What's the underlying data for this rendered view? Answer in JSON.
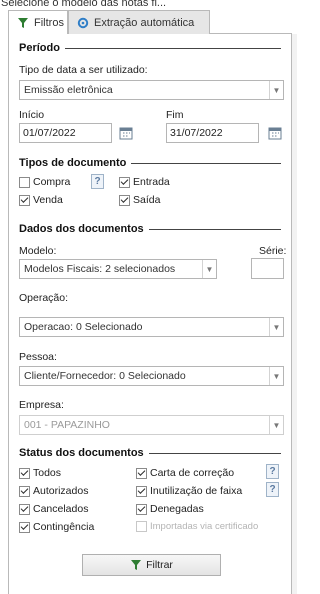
{
  "header_cut_text": "Selecione o modelo das notas fi...",
  "tabs": [
    {
      "label": "Filtros",
      "icon": "filter-icon",
      "active": true
    },
    {
      "label": "Extração automática",
      "icon": "gear-icon",
      "active": false
    }
  ],
  "periodo": {
    "title": "Período",
    "date_type_label": "Tipo de data a ser utilizado:",
    "date_type_value": "Emissão eletrônica",
    "inicio_label": "Início",
    "inicio_value": "01/07/2022",
    "fim_label": "Fim",
    "fim_value": "31/07/2022"
  },
  "tipos": {
    "title": "Tipos de documento",
    "compra": {
      "label": "Compra",
      "checked": false
    },
    "entrada": {
      "label": "Entrada",
      "checked": true
    },
    "venda": {
      "label": "Venda",
      "checked": true
    },
    "saida": {
      "label": "Saída",
      "checked": true
    }
  },
  "dados": {
    "title": "Dados dos documentos",
    "modelo_label": "Modelo:",
    "modelo_value": "Modelos Fiscais: 2 selecionados",
    "serie_label": "Série:",
    "operacao_label": "Operação:",
    "operacao_value": "Operacao: 0 Selecionado",
    "pessoa_label": "Pessoa:",
    "pessoa_value": "Cliente/Fornecedor: 0 Selecionado",
    "empresa_label": "Empresa:",
    "empresa_value": "001 - PAPAZINHO"
  },
  "status": {
    "title": "Status dos documentos",
    "todos": {
      "label": "Todos",
      "checked": true
    },
    "carta": {
      "label": "Carta de correção",
      "checked": true
    },
    "autorizados": {
      "label": "Autorizados",
      "checked": true
    },
    "inutilizacao": {
      "label": "Inutilização de faixa",
      "checked": true
    },
    "cancelados": {
      "label": "Cancelados",
      "checked": true
    },
    "denegadas": {
      "label": "Denegadas",
      "checked": true
    },
    "contingencia": {
      "label": "Contingência",
      "checked": true
    },
    "importadas": {
      "label": "Importadas via certificado",
      "checked": false
    }
  },
  "help_symbol": "?",
  "filter_button_label": "Filtrar",
  "colors": {
    "accent_filter": "#2e7d32",
    "gear": "#2f7ec7"
  }
}
